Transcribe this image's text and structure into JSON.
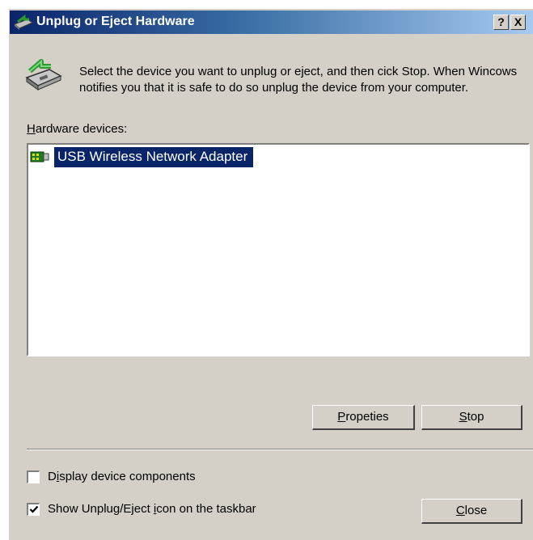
{
  "window": {
    "title": "Unplug or Eject Hardware",
    "help_button": "?",
    "close_button": "X",
    "title_icon": "eject-hardware-icon"
  },
  "intro": {
    "icon": "unplug-hardware-icon",
    "text": "Select the device you want to unplug or eject, and then cick Stop. When Wincows notifies you that it is safe to do so unplug the device from your computer."
  },
  "hardware_devices": {
    "label_accel": "H",
    "label_rest": "ardware devices:",
    "items": [
      {
        "label": "USB Wireless Network Adapter",
        "icon": "network-adapter-icon",
        "selected": true
      }
    ]
  },
  "buttons": {
    "properties": {
      "accel": "P",
      "rest": "ropeties"
    },
    "stop": {
      "accel": "S",
      "rest": "top"
    },
    "close": {
      "accel": "C",
      "rest": "lose"
    }
  },
  "options": {
    "display_components": {
      "pre": "D",
      "accel": "i",
      "rest": "splay device components",
      "checked": false
    },
    "show_icon": {
      "pre": "Show Unplug/Eject ",
      "accel": "i",
      "rest": "con on the taskbar",
      "checked": true
    }
  },
  "colors": {
    "title_gradient_start": "#0a246a",
    "title_gradient_end": "#a6caf0",
    "selection": "#0a246a",
    "face": "#d4d0c8"
  }
}
